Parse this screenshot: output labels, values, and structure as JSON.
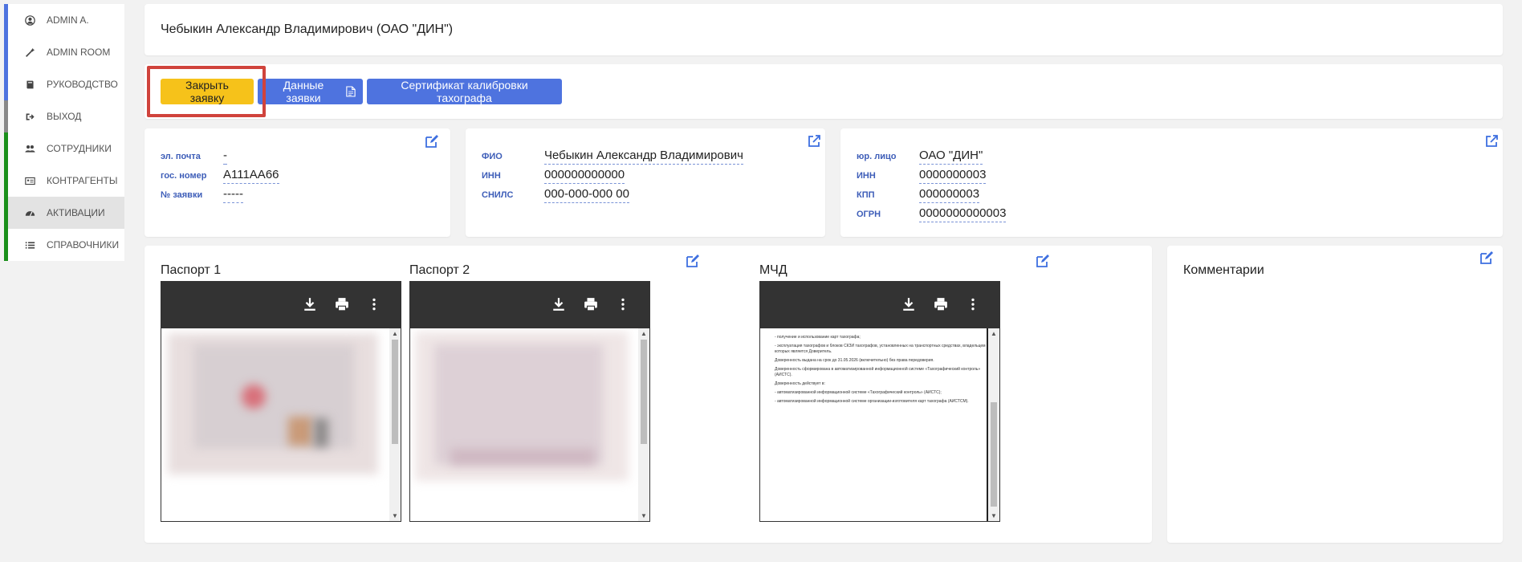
{
  "sidebar": {
    "items": [
      {
        "label": "ADMIN A.",
        "icon": "user-circle-icon"
      },
      {
        "label": "ADMIN ROOM",
        "icon": "magic-wand-icon"
      },
      {
        "label": "РУКОВОДСТВО",
        "icon": "book-icon"
      },
      {
        "label": "ВЫХОД",
        "icon": "sign-out-icon"
      },
      {
        "label": "СОТРУДНИКИ",
        "icon": "users-icon"
      },
      {
        "label": "КОНТРАГЕНТЫ",
        "icon": "id-card-icon"
      },
      {
        "label": "АКТИВАЦИИ",
        "icon": "dashboard-icon"
      },
      {
        "label": "СПРАВОЧНИКИ",
        "icon": "list-icon"
      }
    ]
  },
  "header": {
    "title": "Чебыкин Александр Владимирович (ОАО \"ДИН\")"
  },
  "actions": {
    "close_label": "Закрыть заявку",
    "data_label": "Данные заявки",
    "cert_label": "Сертификат калибровки тахографа"
  },
  "request_info": {
    "email_label": "эл. почта",
    "email_value": "-",
    "plate_label": "гос. номер",
    "plate_value": "А111АА66",
    "number_label": "№ заявки",
    "number_value": "-----"
  },
  "person_info": {
    "fio_label": "ФИО",
    "fio_value": "Чебыкин Александр Владимирович",
    "inn_label": "ИНН",
    "inn_value": "000000000000",
    "snils_label": "СНИЛС",
    "snils_value": "000-000-000 00"
  },
  "company_info": {
    "entity_label": "юр. лицо",
    "entity_value": "ОАО \"ДИН\"",
    "inn_label": "ИНН",
    "inn_value": "0000000003",
    "kpp_label": "КПП",
    "kpp_value": "000000003",
    "ogrn_label": "ОГРН",
    "ogrn_value": "0000000000003"
  },
  "documents": {
    "passport1_title": "Паспорт 1",
    "passport2_title": "Паспорт 2",
    "mchd_title": "МЧД",
    "mchd_text": [
      "- получение и использование карт тахографа;",
      "- эксплуатация тахографов и блоков СКЗИ тахографов, установленных на транспортных средствах, владельцем которых является Доверитель.",
      "Доверенность выдана на срок до 31.05.2026 (включительно) без права передоверия.",
      "Доверенность сформирована в автоматизированной информационной системе «Тахографический контроль» (АИСТС).",
      "Доверенность действует в:",
      "- автоматизированной информационной системе «Тахографический контроль» (АИСТС);",
      "- автоматизированной информационной системе организации-изготовителя карт тахографа (АИСТСМ)."
    ]
  },
  "comments": {
    "title": "Комментарии"
  },
  "colors": {
    "accent": "#4e73df",
    "warning": "#f6c21a",
    "highlight": "#d0433c",
    "success": "#1a8f1a"
  }
}
